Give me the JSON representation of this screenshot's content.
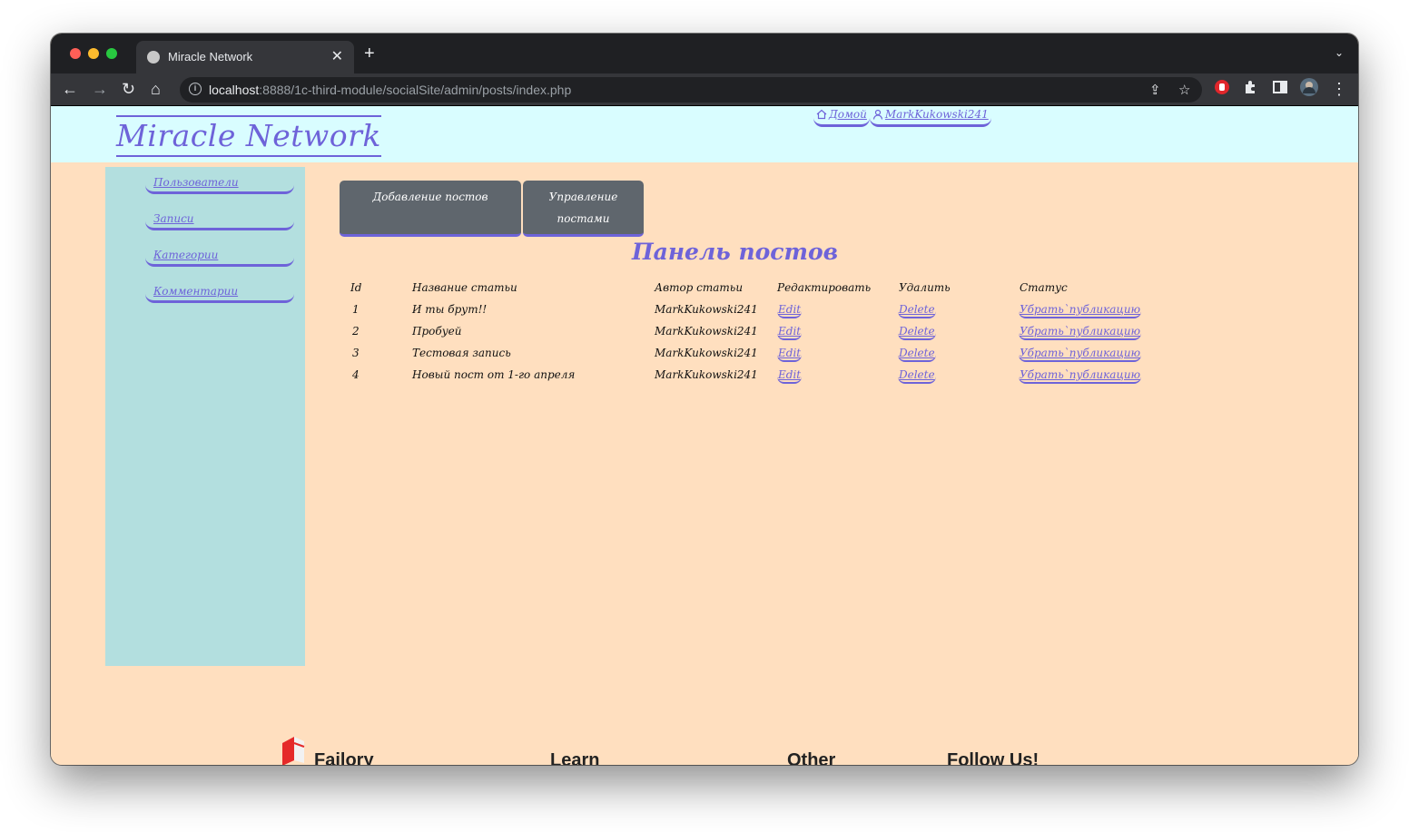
{
  "browser": {
    "tab_title": "Miracle Network",
    "tab_close": "✕",
    "new_tab": "+",
    "tab_menu": "⌄",
    "url_host": "localhost",
    "url_rest": ":8888/1c-third-module/socialSite/admin/posts/index.php",
    "back": "←",
    "forward": "→",
    "reload": "↻",
    "home": "⌂",
    "share": "⇪",
    "bookmark": "☆",
    "menu": "⋮"
  },
  "site": {
    "logo": "Miracle Network",
    "nav": [
      {
        "label": "Домой",
        "icon": "home-icon"
      },
      {
        "label": "MarkKukowski241",
        "icon": "user-icon"
      }
    ]
  },
  "sidebar": {
    "items": [
      {
        "label": "Пользователи"
      },
      {
        "label": "Записи"
      },
      {
        "label": "Категории"
      },
      {
        "label": "Комментарии"
      }
    ]
  },
  "main": {
    "tabs": [
      {
        "label": "Добавление постов"
      },
      {
        "label_line1": "Управление",
        "label_line2": "постами"
      }
    ],
    "title": "Панель постов",
    "table": {
      "headers": [
        "Id",
        "Название статьи",
        "Автор статьи",
        "Редактировать",
        "Удалить",
        "Статус"
      ],
      "rows": [
        {
          "id": "1",
          "title": "И ты брут!!",
          "author": "MarkKukowski241",
          "edit": "Edit",
          "delete": "Delete",
          "status": "Убрать`публикацию"
        },
        {
          "id": "2",
          "title": "Пробуей",
          "author": "MarkKukowski241",
          "edit": "Edit",
          "delete": "Delete",
          "status": "Убрать`публикацию"
        },
        {
          "id": "3",
          "title": "Тестовая запись",
          "author": "MarkKukowski241",
          "edit": "Edit",
          "delete": "Delete",
          "status": "Убрать`публикацию"
        },
        {
          "id": "4",
          "title": "Новый пост от 1-го апреля",
          "author": "MarkKukowski241",
          "edit": "Edit",
          "delete": "Delete",
          "status": "Убрать`публикацию"
        }
      ]
    }
  },
  "footer": {
    "brand": "Failory",
    "columns": [
      "Learn",
      "Other",
      "Follow Us!"
    ]
  },
  "colors": {
    "accent": "#6e63d9",
    "header_bg": "#d9fdff",
    "page_bg": "#ffdfbf",
    "sidebar_bg": "#b3dfdf",
    "button_bg": "#5f666d"
  }
}
